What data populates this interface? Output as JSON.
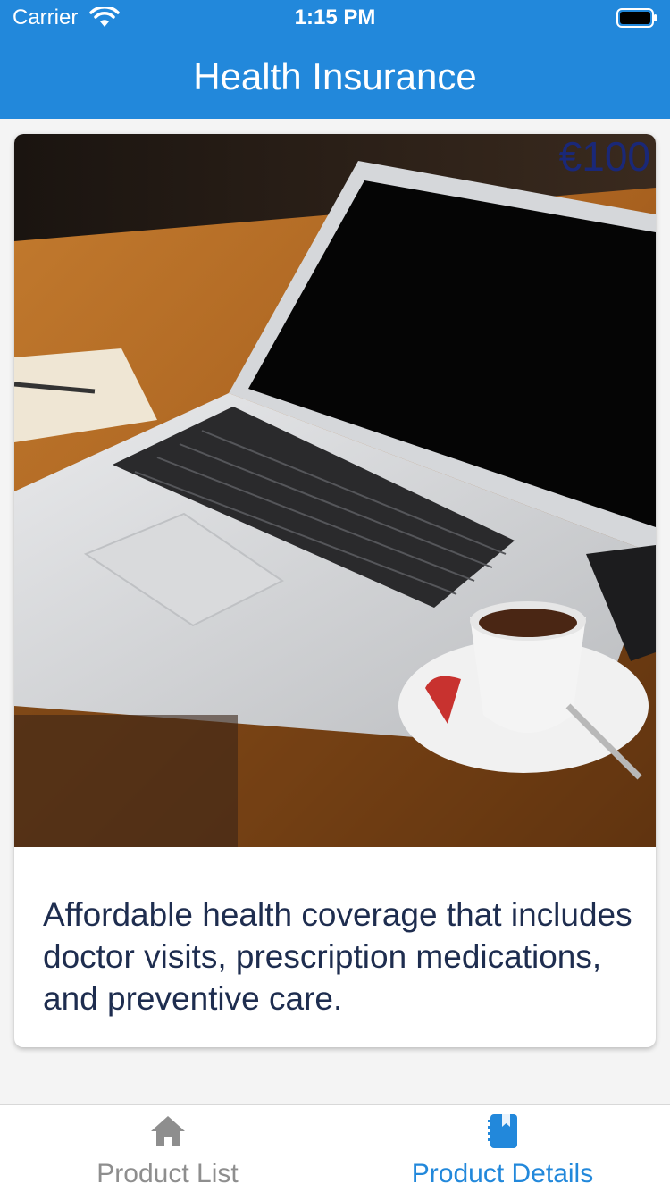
{
  "status_bar": {
    "carrier": "Carrier",
    "time": "1:15 PM"
  },
  "nav": {
    "title": "Health Insurance"
  },
  "product": {
    "price": "€100",
    "description": "Affordable health coverage that includes doctor visits, prescription medications, and preventive care.",
    "image_subject": "laptop on wooden desk with coffee cup"
  },
  "tabs": [
    {
      "label": "Product List",
      "icon": "home-icon",
      "active": false
    },
    {
      "label": "Product Details",
      "icon": "notebook-icon",
      "active": true
    }
  ],
  "colors": {
    "accent": "#2288db",
    "price": "#1a2878",
    "text": "#1e2d4f",
    "inactive_tab": "#8e8e8e"
  }
}
